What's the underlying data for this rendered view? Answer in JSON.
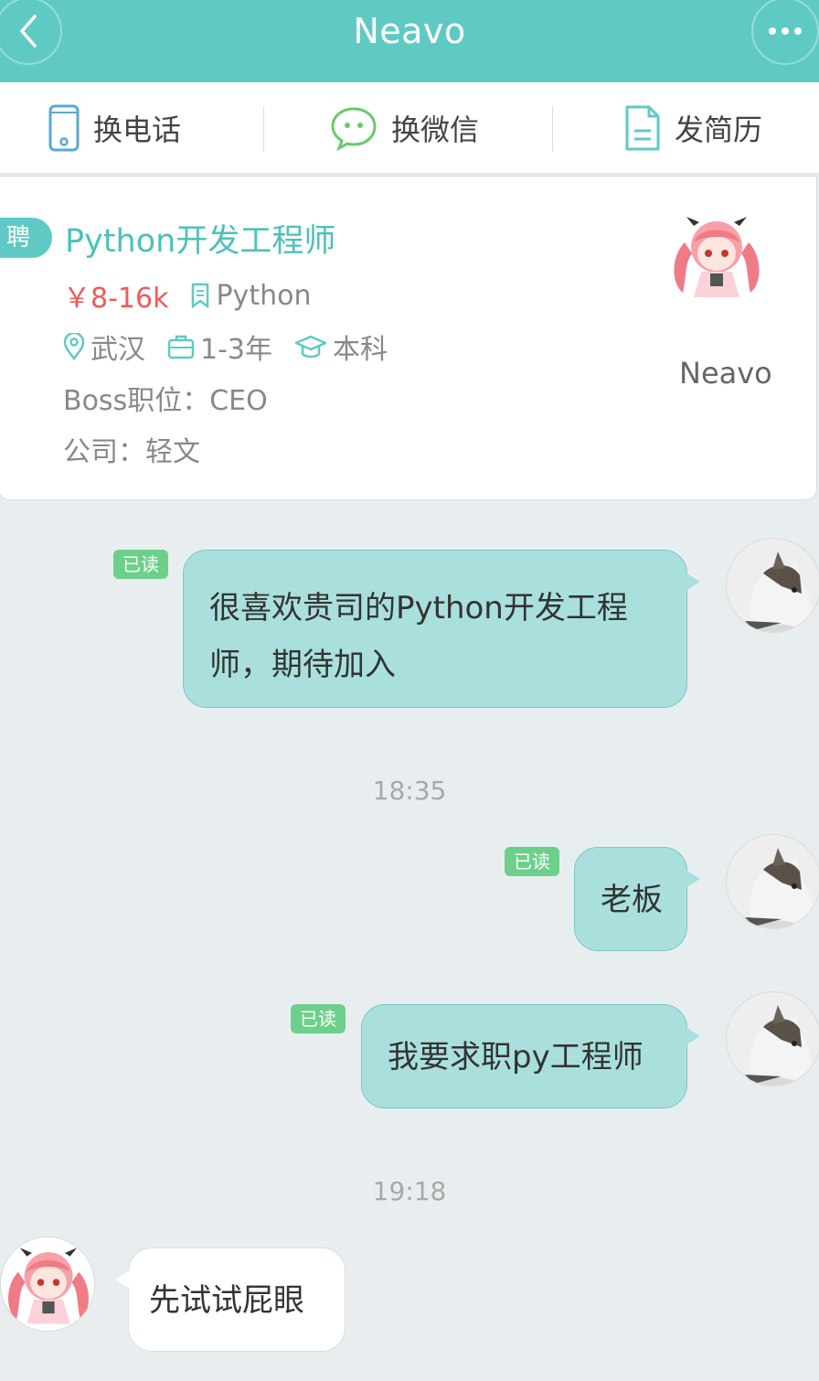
{
  "header": {
    "title": "Neavo"
  },
  "actions": [
    {
      "label": "换电话",
      "icon": "phone-icon"
    },
    {
      "label": "换微信",
      "icon": "wechat-icon"
    },
    {
      "label": "发简历",
      "icon": "resume-icon"
    }
  ],
  "job": {
    "tag": "聘",
    "title": "Python开发工程师",
    "salary": "￥8-16k",
    "skill": "Python",
    "location": "武汉",
    "experience": "1-3年",
    "education": "本科",
    "boss_position": "Boss职位：CEO",
    "company": "公司：轻文",
    "boss_name": "Neavo"
  },
  "chat": {
    "read_label": "已读",
    "messages": [
      {
        "text_line1": "很喜欢贵司的Python开发工程",
        "text_line2": "师，期待加入"
      },
      {
        "text": "老板"
      },
      {
        "text": "我要求职py工程师"
      },
      {
        "text": "先试试屁眼"
      }
    ],
    "times": [
      "18:35",
      "19:18"
    ]
  },
  "colors": {
    "accent": "#5fcac4",
    "bubble": "#a9e0dd",
    "salary": "#f05a5a",
    "read_badge": "#6dd08a"
  }
}
